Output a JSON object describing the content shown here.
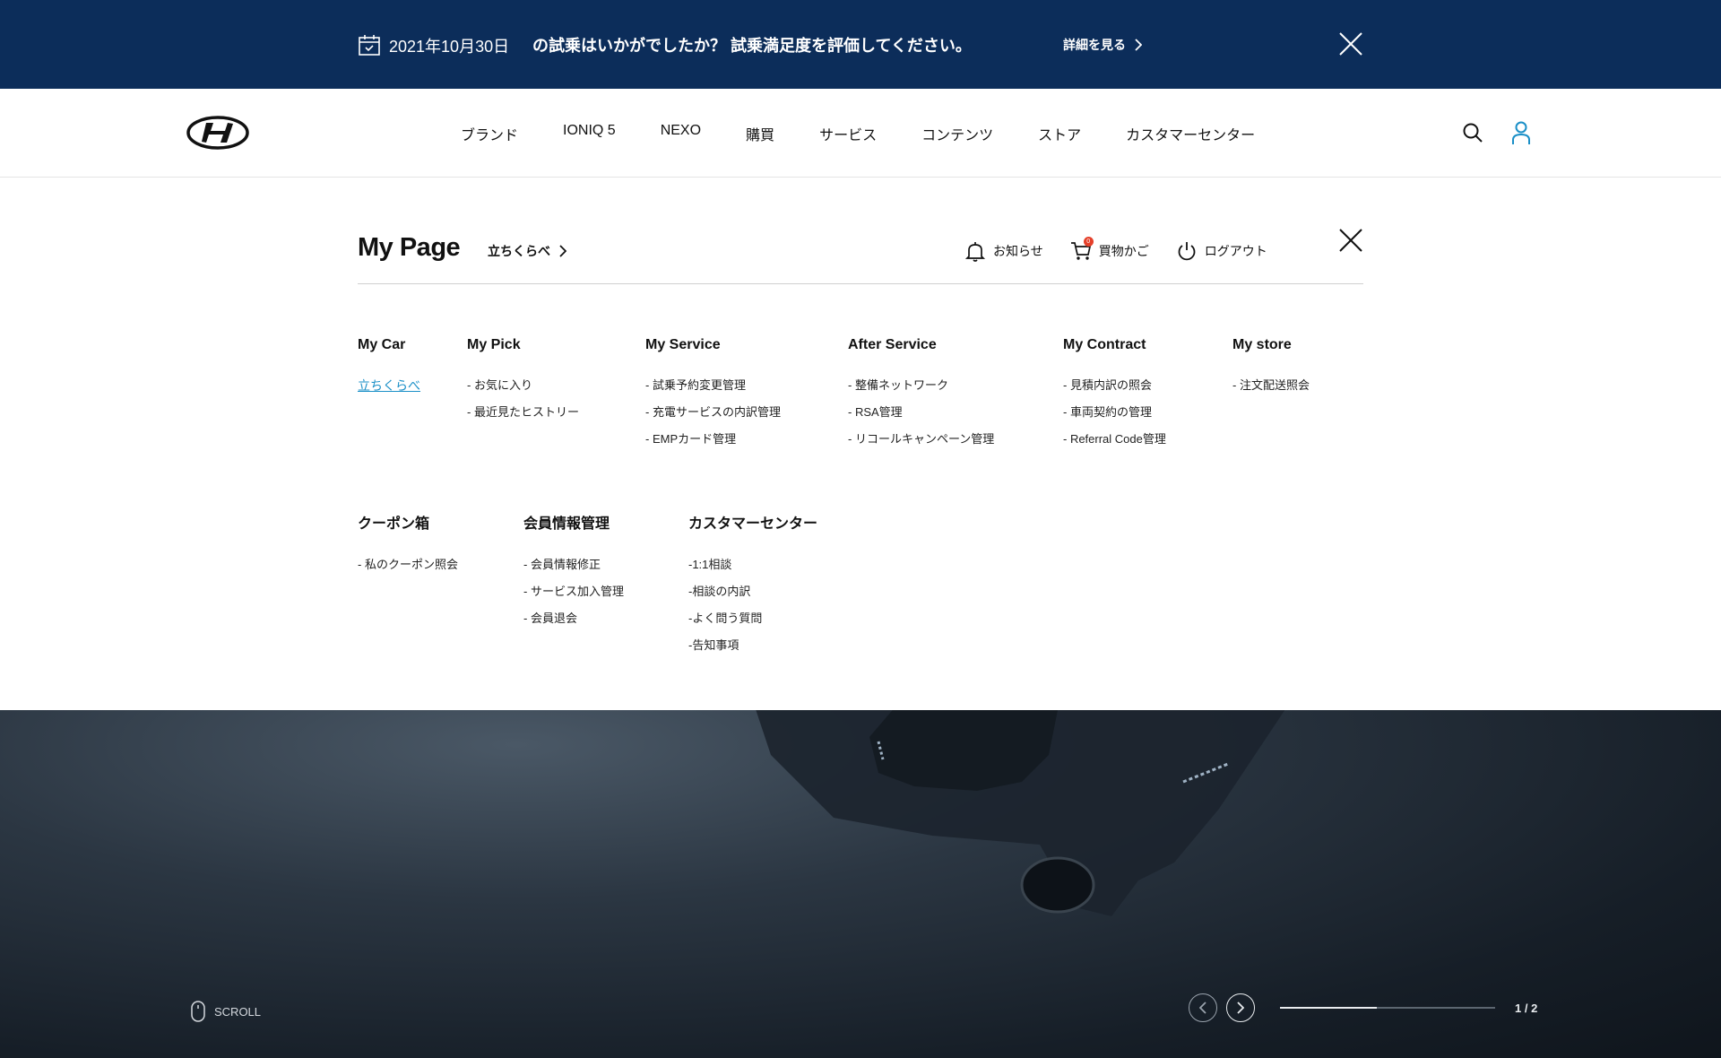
{
  "banner": {
    "date": "2021年10月30日",
    "message": "の試乗はいかがでしたか？ 試乗満足度を評価してください。",
    "detail_label": "詳細を見る",
    "bg_color": "#0c2d5a"
  },
  "header": {
    "nav": [
      "ブランド",
      "IONIQ 5",
      "NEXO",
      "購買",
      "サービス",
      "コンテンツ",
      "ストア",
      "カスタマーセンター"
    ],
    "user_icon_color": "#1a8fc7"
  },
  "mypage": {
    "title": "My Page",
    "compare_label": "立ちくらべ",
    "tools": {
      "notice": "お知らせ",
      "cart": "買物かご",
      "cart_count": "0",
      "logout": "ログアウト"
    },
    "sections": {
      "mycar": {
        "title": "My Car",
        "items": [
          "立ちくらべ"
        ]
      },
      "mypick": {
        "title": "My Pick",
        "items": [
          "- お気に入り",
          "- 最近見たヒストリー"
        ]
      },
      "myservice": {
        "title": "My Service",
        "items": [
          "- 試乗予約変更管理",
          "- 充電サービスの内訳管理",
          "- EMPカード管理"
        ]
      },
      "afterservice": {
        "title": "After Service",
        "items": [
          "- 整備ネットワーク",
          "- RSA管理",
          "- リコールキャンペーン管理"
        ]
      },
      "mycontract": {
        "title": "My Contract",
        "items": [
          "- 見積内訳の照会",
          "- 車両契約の管理",
          "- Referral Code管理"
        ]
      },
      "mystore": {
        "title": "My store",
        "items": [
          "- 注文配送照会"
        ]
      },
      "coupon": {
        "title": "クーポン箱",
        "items": [
          "- 私のクーポン照会"
        ]
      },
      "member": {
        "title": "会員情報管理",
        "items": [
          "- 会員情報修正",
          "- サービス加入管理",
          "- 会員退会"
        ]
      },
      "customer": {
        "title": "カスタマーセンター",
        "items": [
          "-1:1相談",
          "-相談の内訳",
          "-よく問う質問",
          "-告知事項"
        ]
      }
    }
  },
  "hero": {
    "scroll_label": "SCROLL",
    "pager": "1 / 2",
    "progress": 0.45
  }
}
